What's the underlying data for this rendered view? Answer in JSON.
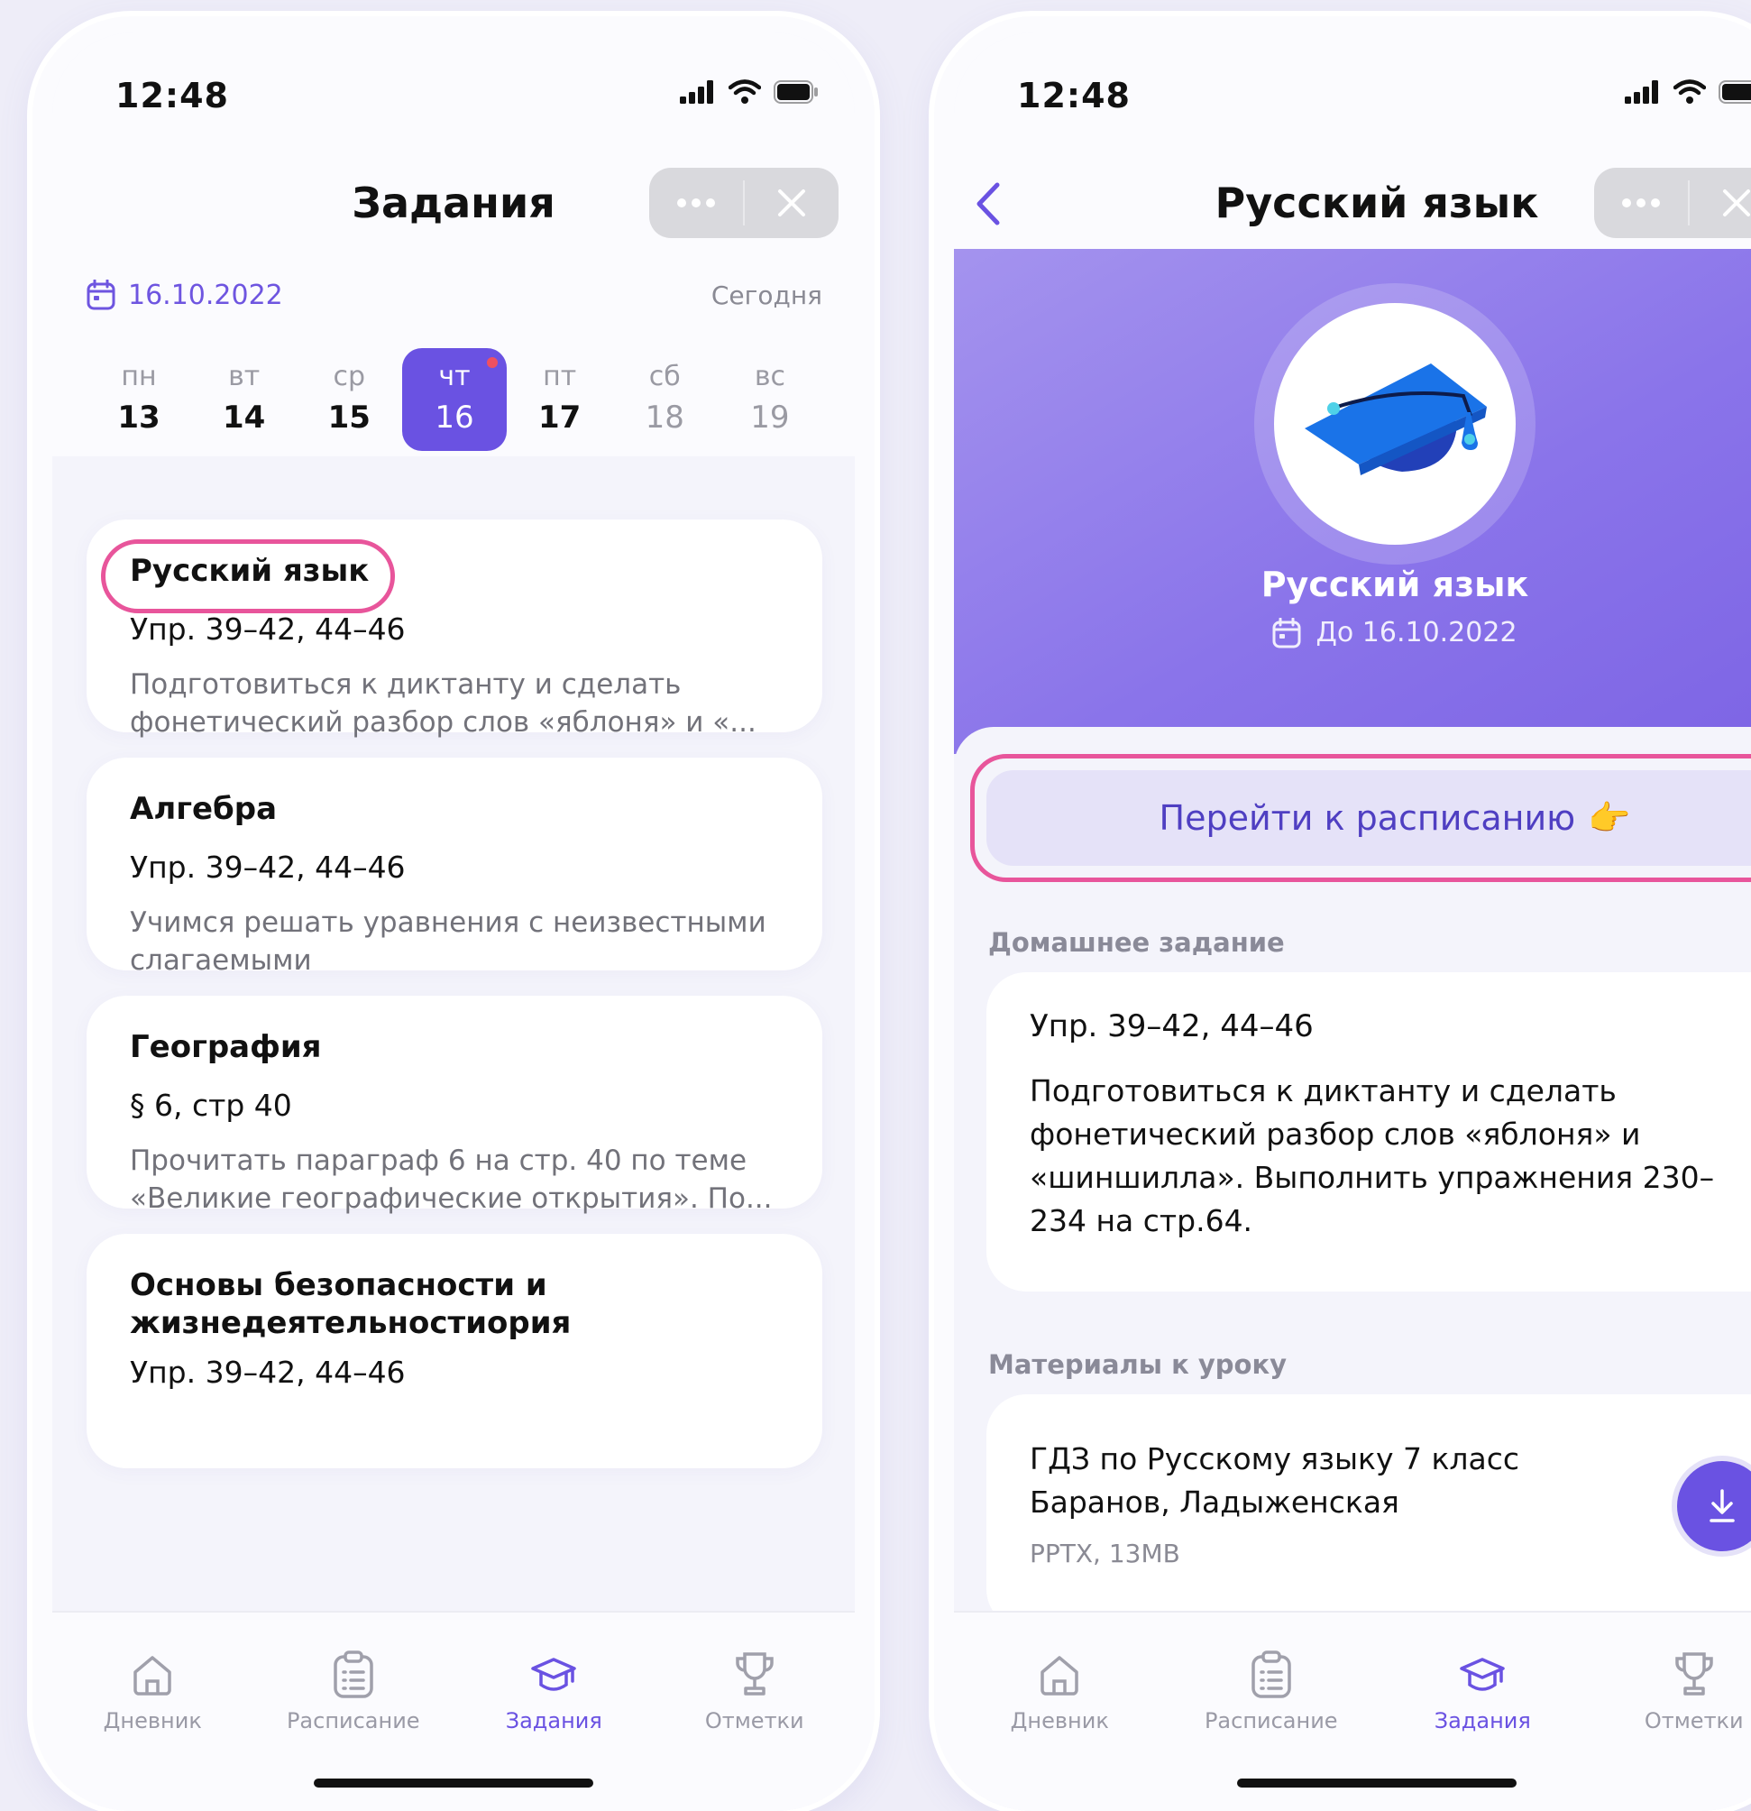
{
  "left": {
    "status_time": "12:48",
    "title": "Задания",
    "date": "16.10.2022",
    "today_label": "Сегодня",
    "week": [
      {
        "wd": "пн",
        "dn": "13"
      },
      {
        "wd": "вт",
        "dn": "14"
      },
      {
        "wd": "ср",
        "dn": "15"
      },
      {
        "wd": "чт",
        "dn": "16"
      },
      {
        "wd": "пт",
        "dn": "17"
      },
      {
        "wd": "сб",
        "dn": "18"
      },
      {
        "wd": "вс",
        "dn": "19"
      }
    ],
    "assignments": [
      {
        "subject": "Русский язык",
        "exercise": "Упр. 39–42, 44–46",
        "description": "Подготовиться к диктанту и сделать фонетический разбор слов «яблоня» и «..."
      },
      {
        "subject": "Алгебра",
        "exercise": "Упр. 39–42, 44–46",
        "description": "Учимся решать уравнения с неизвестными слагаемыми"
      },
      {
        "subject": "География",
        "exercise": "§ 6, стр 40",
        "description": "Прочитать параграф 6 на стр. 40 по теме «Великие географические открытия». По..."
      },
      {
        "subject": "Основы безопасности и жизнедеятельностиория",
        "exercise": "Упр. 39–42, 44–46",
        "description": ""
      }
    ]
  },
  "right": {
    "status_time": "12:48",
    "title": "Русский язык",
    "hero_subject": "Русский язык",
    "hero_due": "До 16.10.2022",
    "cta_label": "Перейти к расписанию",
    "cta_emoji": "👉",
    "homework_label": "Домашнее задание",
    "homework": {
      "exercise": "Упр. 39–42, 44–46",
      "description": "Подготовиться к диктанту и сделать фонетический разбор слов «яблоня» и «шиншилла». Выполнить упражнения 230–234 на стр.64."
    },
    "materials_label": "Материалы к уроку",
    "material": {
      "title": "ГДЗ по Русскому языку 7 класс Баранов, Ладыженская",
      "meta": "PPTX, 13MB"
    }
  },
  "tabs": [
    "Дневник",
    "Расписание",
    "Задания",
    "Отметки"
  ],
  "icons": {
    "tab_icons": [
      "home-icon",
      "clipboard-icon",
      "graduation-cap-icon",
      "trophy-icon"
    ],
    "capsule": [
      "more-icon",
      "close-icon"
    ]
  },
  "colors": {
    "accent": "#6a52e2",
    "highlight": "#e8559b",
    "hero_gradient": [
      "#a493ee",
      "#7c63e4"
    ],
    "cap_blue": "#1a73e8"
  }
}
